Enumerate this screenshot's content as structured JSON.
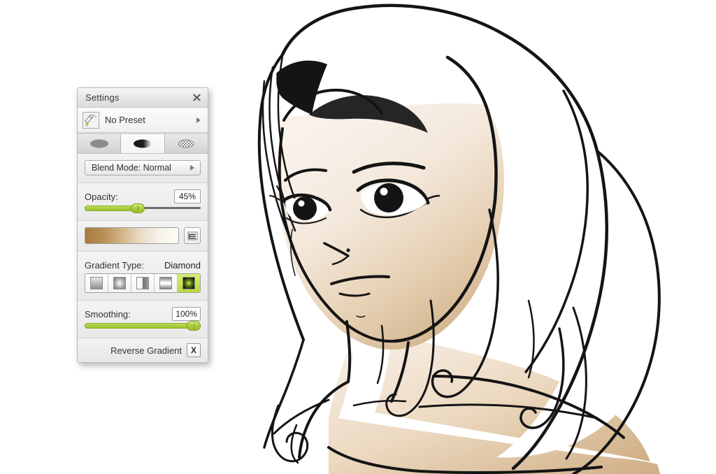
{
  "app": {
    "background_color": "#ffffff"
  },
  "panel": {
    "title": "Settings",
    "close_icon": "close-icon",
    "preset": {
      "label": "No Preset",
      "thumb_icon": "preset-thumbnail-icon",
      "expand_icon": "triangle-right-icon"
    },
    "tabs": [
      {
        "name": "solid-color-tab",
        "icon": "solid-ellipse-icon",
        "active": false
      },
      {
        "name": "gradient-tab",
        "icon": "gradient-ellipse-icon",
        "active": true
      },
      {
        "name": "pattern-tab",
        "icon": "checkered-ellipse-icon",
        "active": false
      }
    ],
    "blend_mode": {
      "label": "Blend Mode: Normal",
      "expand_icon": "triangle-right-icon"
    },
    "opacity": {
      "label": "Opacity:",
      "value": "45%",
      "percent": 45
    },
    "gradient_preview": {
      "name": "gradient-preview-bar",
      "stops": [
        "#a97b3e",
        "#b98f55",
        "#d4b68c",
        "#eadcc8",
        "#f7f2e9",
        "#fdfcf9"
      ],
      "menu_icon": "list-menu-icon"
    },
    "gradient_type": {
      "label": "Gradient Type:",
      "selected_name": "Diamond",
      "options": [
        {
          "name": "linear-gradient-type",
          "selected": false
        },
        {
          "name": "radial-gradient-type",
          "selected": false
        },
        {
          "name": "linear-horizontal-gradient-type",
          "selected": false
        },
        {
          "name": "reflected-gradient-type",
          "selected": false
        },
        {
          "name": "diamond-gradient-type",
          "selected": true
        }
      ]
    },
    "smoothing": {
      "label": "Smoothing:",
      "value": "100%",
      "percent": 100
    },
    "reverse_gradient": {
      "label": "Reverse Gradient",
      "checked_mark": "X"
    },
    "accent_color": "#b9dc3c",
    "slider_color": "#9cc22e"
  },
  "artwork": {
    "name": "manga-woman-portrait-lineart",
    "description": "Black-and-white line art portrait of a young woman with long flowing hair, skin filled with a tan gradient",
    "line_color": "#141414",
    "skin_light": "#f7efe8",
    "skin_mid": "#e9d8c2",
    "skin_dark": "#d4b48d",
    "hair_color": "#ffffff"
  }
}
